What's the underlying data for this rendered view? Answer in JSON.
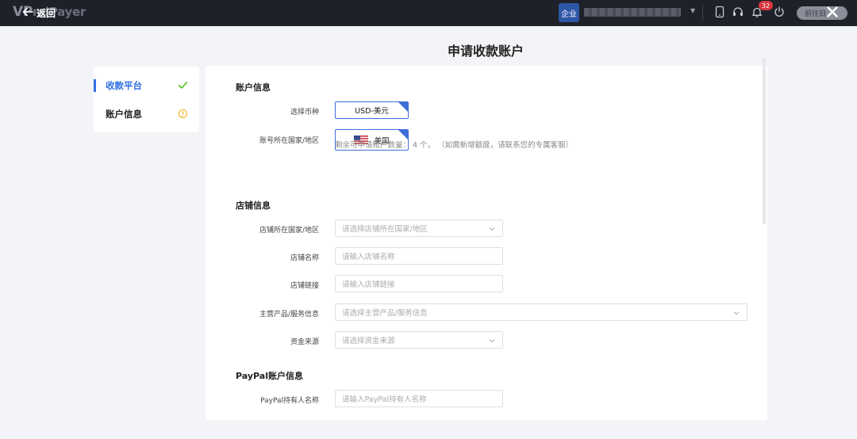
{
  "topbar": {
    "brand_prefix": "VP",
    "brand_suffix": "ndPayer",
    "back_label": "返回",
    "org_badge": "企业",
    "notification_count": "32",
    "goto_label": "前往旧"
  },
  "page": {
    "title": "申请收款账户"
  },
  "steps": [
    {
      "label": "收款平台",
      "status": "complete",
      "color": "#2f6fe4"
    },
    {
      "label": "账户信息",
      "status": "warning",
      "color": "#222222"
    }
  ],
  "account_info": {
    "title": "账户信息",
    "currency_label": "选择币种",
    "currency_value": "USD-美元",
    "country_label": "账号所在国家/地区",
    "country_value": "美国",
    "country_flag": "us-flag-icon",
    "hint": "剩余可申请账户数量： 4 个， （如需新增额度，请联系您的专属客服）"
  },
  "store_info": {
    "title": "店铺信息",
    "country_label": "店铺所在国家/地区",
    "country_placeholder": "请选择店铺所在国家/地区",
    "name_label": "店铺名称",
    "name_placeholder": "请输入店铺名称",
    "link_label": "店铺链接",
    "link_placeholder": "请输入店铺链接",
    "product_label": "主营产品/服务信息",
    "product_placeholder": "请选择主营产品/服务信息",
    "funds_label": "资金来源",
    "funds_placeholder": "请选择资金来源"
  },
  "paypal_info": {
    "title": "PayPal账户信息",
    "holder_label": "PayPal持有人名称",
    "holder_placeholder": "请输入PayPal持有人名称"
  },
  "colors": {
    "accent": "#2f6fe4",
    "success": "#52c41a",
    "warning": "#faad14",
    "topbar": "#1f2129"
  }
}
